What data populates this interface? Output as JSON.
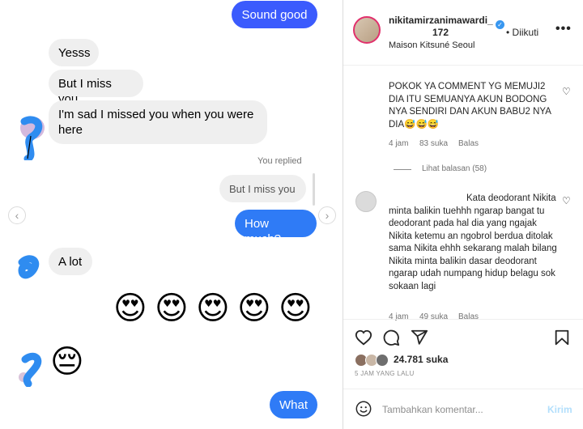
{
  "dm": {
    "sent_top": "Sound good",
    "recv1": "Yesss",
    "recv2": "But I miss you",
    "recv3": "I'm sad I missed you when you were here",
    "replied_label": "You replied",
    "replied_quote": "But I miss you",
    "sent_howmuch": "How much?",
    "recv_alot": "A lot",
    "emoji_row": [
      "😍",
      "😍",
      "😍",
      "😍",
      "😍"
    ],
    "emoji_sad": "😔",
    "sent_what": "What",
    "nav_prev": "‹",
    "nav_next": "›"
  },
  "post": {
    "username_line1": "nikitamirzanimawardi_",
    "username_line2": "172",
    "follow_label": "Diikuti",
    "dot_sep": "•",
    "more_label": "•••",
    "location": "Maison Kitsuné Seoul",
    "comments": [
      {
        "text": "POKOK YA COMMENT YG MEMUJI2 DIA ITU SEMUANYA AKUN BODONG NYA SENDIRI DAN AKUN BABU2 NYA DIA😅😅😅",
        "time": "4 jam",
        "likes": "83 suka",
        "reply": "Balas",
        "view_replies": "Lihat balasan (58)"
      },
      {
        "text": "Kata deodorant Nikita minta balikin tuehhh ngarap bangat tu deodorant pada hal dia yang ngajak Nikita ketemu an ngobrol berdua ditolak sama Nikita ehhh sekarang malah bilang Nikita minta balikin dasar deodorant ngarap udah numpang hidup belagu sok sokaan lagi",
        "time": "4 jam",
        "likes": "49 suka",
        "reply": "Balas"
      }
    ],
    "likes_count": "24.781 suka",
    "time_ago": "5 JAM YANG LALU",
    "add_comment_placeholder": "Tambahkan komentar...",
    "post_button": "Kirim"
  },
  "colors": {
    "sent_bubble": "#3b5bfd",
    "sent_bubble_alt": "#2f7bf6",
    "recv_bubble": "#efefef",
    "verified": "#3897f0",
    "scribble": "#2f8cf0"
  }
}
